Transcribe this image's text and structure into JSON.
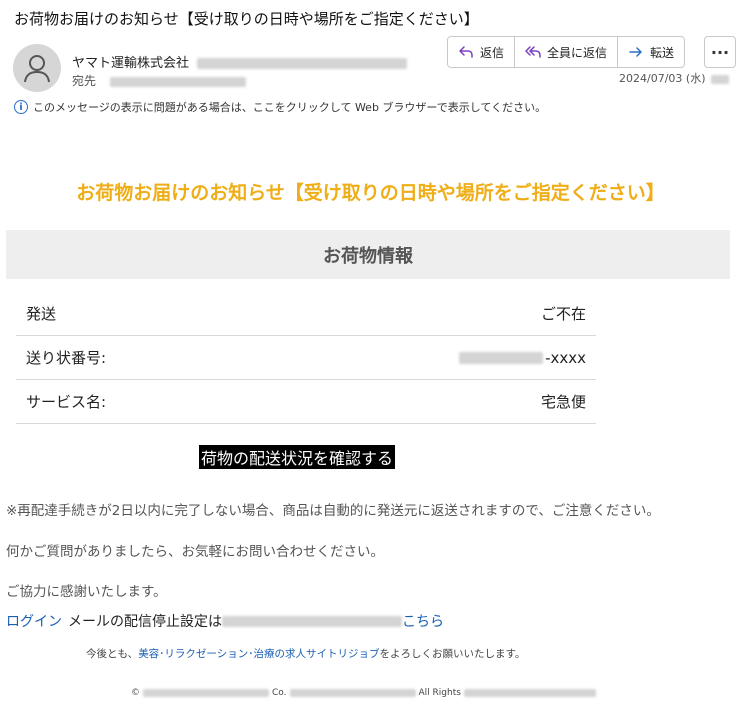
{
  "header": {
    "subject": "お荷物お届けのお知らせ【受け取りの日時や場所をご指定ください】",
    "sender_name": "ヤマト運輸株式会社",
    "recipient_label": "宛先",
    "date": "2024/07/03 (水)"
  },
  "actions": {
    "reply": "返信",
    "reply_all": "全員に返信",
    "forward": "転送",
    "more": "···"
  },
  "info_bar": {
    "text": "このメッセージの表示に問題がある場合は、ここをクリックして Web ブラウザーで表示してください。"
  },
  "email": {
    "headline": "お荷物お届けのお知らせ【受け取りの日時や場所をご指定ください】",
    "package_info_header": "お荷物情報",
    "rows": [
      {
        "label": "発送",
        "value": "ご不在"
      },
      {
        "label": "送り状番号:",
        "value": "-xxxx"
      },
      {
        "label": "サービス名:",
        "value": "宅急便"
      }
    ],
    "track_button": "荷物の配送状況を確認する",
    "notice": "※再配達手続きが2日以内に完了しない場合、商品は自動的に発送元に返送されますので、ご注意ください。",
    "questions": "何かご質問がありましたら、お気軽にお問い合わせください。",
    "thanks": "ご協力に感謝いたします。",
    "login_link": "ログイン",
    "unsubscribe_text": "メールの配信停止設定は",
    "here_link": "こちら",
    "outro_prefix": "今後とも、",
    "outro_link": "美容･リラクゼーション･治療の求人サイトリジョブ",
    "outro_suffix": "をよろしくお願いいたします。",
    "copyright_symbol": "©",
    "copyright_co": "Co.",
    "copyright_rights": "All Rights"
  },
  "colors": {
    "headline": "#efae17",
    "link": "#1a5fb4",
    "button_bg": "#000000",
    "package_header_bg": "#eeeeee"
  }
}
